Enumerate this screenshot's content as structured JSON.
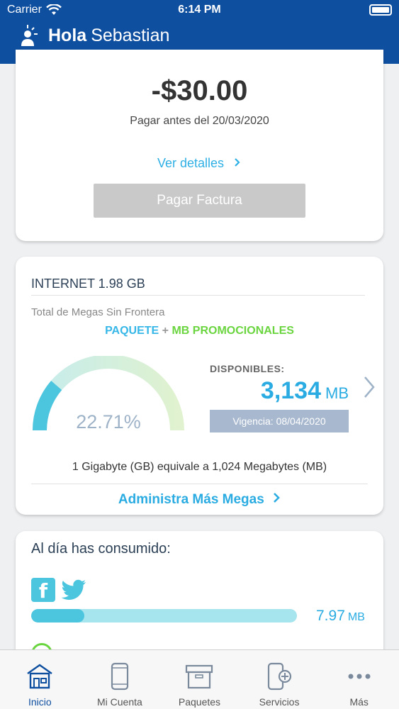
{
  "status_bar": {
    "carrier": "Carrier",
    "time": "6:14 PM"
  },
  "header": {
    "greeting_bold": "Hola",
    "user_name": "Sebastian"
  },
  "bill": {
    "amount": "-$30.00",
    "due_text": "Pagar antes del 20/03/2020",
    "details_link": "Ver detalles",
    "pay_button": "Pagar Factura"
  },
  "internet": {
    "title": "INTERNET 1.98 GB",
    "megas_label": "Total de Megas Sin Frontera",
    "legend_paquete": "PAQUETE",
    "legend_plus": "+",
    "legend_mb": "MB PROMOCIONALES",
    "percent_text": "22.71%",
    "percent_value": 22.71,
    "available_label": "DISPONIBLES:",
    "available_value": "3,134",
    "available_unit": "MB",
    "validity": "Vigencia: 08/04/2020",
    "equivalence": "1 Gigabyte (GB) equivale a 1,024 Megabytes (MB)",
    "manage_link": "Administra Más Megas"
  },
  "consumption": {
    "title": "Al día has consumido:",
    "value": "7.97",
    "unit": "MB",
    "fraction": 0.2
  },
  "tabs": [
    {
      "label": "Inicio",
      "icon": "home-icon"
    },
    {
      "label": "Mi Cuenta",
      "icon": "phone-icon"
    },
    {
      "label": "Paquetes",
      "icon": "package-icon"
    },
    {
      "label": "Servicios",
      "icon": "phone-plus-icon"
    },
    {
      "label": "Más",
      "icon": "more-icon"
    }
  ],
  "colors": {
    "header_blue": "#0f4fa0",
    "accent_cyan": "#2aace2",
    "promo_green": "#6ad53f",
    "button_disabled": "#c9c9c9"
  }
}
